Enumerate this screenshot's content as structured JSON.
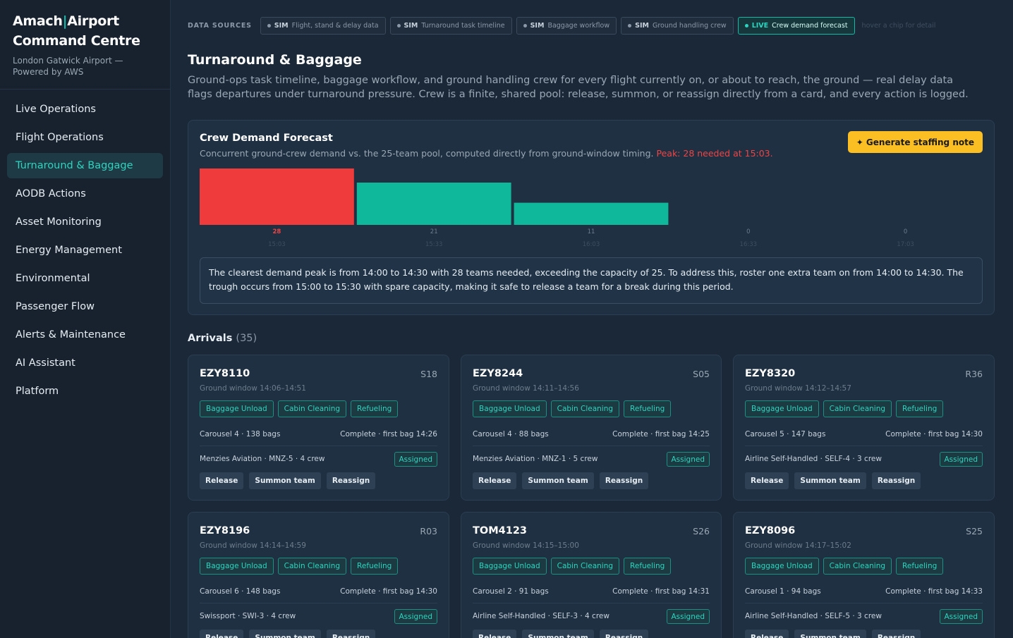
{
  "brand": {
    "name_a": "Amach",
    "name_sep": "|",
    "name_b": "Airport",
    "name_c": "Command Centre",
    "subtitle": "London Gatwick Airport — Powered by AWS"
  },
  "nav": {
    "items": [
      {
        "label": "Live Operations"
      },
      {
        "label": "Flight Operations"
      },
      {
        "label": "Turnaround & Baggage",
        "active": true
      },
      {
        "label": "AODB Actions"
      },
      {
        "label": "Asset Monitoring"
      },
      {
        "label": "Energy Management"
      },
      {
        "label": "Environmental"
      },
      {
        "label": "Passenger Flow"
      },
      {
        "label": "Alerts & Maintenance"
      },
      {
        "label": "AI Assistant"
      },
      {
        "label": "Platform"
      }
    ]
  },
  "sources": {
    "label": "DATA SOURCES",
    "chips": [
      {
        "tag": "SIM",
        "text": "Flight, stand & delay data"
      },
      {
        "tag": "SIM",
        "text": "Turnaround task timeline"
      },
      {
        "tag": "SIM",
        "text": "Baggage workflow"
      },
      {
        "tag": "SIM",
        "text": "Ground handling crew"
      },
      {
        "tag": "LIVE",
        "text": "Crew demand forecast"
      }
    ],
    "hint": "hover a chip for detail"
  },
  "page": {
    "title": "Turnaround & Baggage",
    "description": "Ground-ops task timeline, baggage workflow, and ground handling crew for every flight currently on, or about to reach, the ground — real delay data flags departures under turnaround pressure. Crew is a finite, shared pool: release, summon, or reassign directly from a card, and every action is logged."
  },
  "forecast": {
    "title": "Crew Demand Forecast",
    "subtitle": "Concurrent ground-crew demand vs. the 25-team pool, computed directly from ground-window timing.",
    "peak_text": "Peak: 28 needed at 15:03.",
    "button_label": "✦ Generate staffing note",
    "note": "The clearest demand peak is from 14:00 to 14:30 with 28 teams needed, exceeding the capacity of 25. To address this, roster one extra team on from 14:00 to 14:30. The trough occurs from 15:00 to 15:30 with spare capacity, making it safe to release a team for a break during this period."
  },
  "chart_data": {
    "type": "bar",
    "categories": [
      "15:03",
      "15:33",
      "16:03",
      "16:33",
      "17:03"
    ],
    "values": [
      28,
      21,
      11,
      0,
      0
    ],
    "capacity": 25,
    "colors": {
      "over_capacity": "#ef3b3b",
      "normal": "#0fb89a"
    },
    "title": "",
    "xlabel": "",
    "ylabel": ""
  },
  "arrivals": {
    "title": "Arrivals",
    "count": "(35)",
    "cards": [
      {
        "flight": "EZY8110",
        "stand": "S18",
        "window": "Ground window 14:06–14:51",
        "tasks": [
          "Baggage Unload",
          "Cabin Cleaning",
          "Refueling"
        ],
        "bag": "Carousel 4 · 138 bags",
        "bag_status": "Complete · first bag 14:26",
        "crew": "Menzies Aviation · MNZ-5 · 4 crew",
        "crew_status": "Assigned",
        "actions": [
          "Release",
          "Summon team",
          "Reassign"
        ]
      },
      {
        "flight": "EZY8244",
        "stand": "S05",
        "window": "Ground window 14:11–14:56",
        "tasks": [
          "Baggage Unload",
          "Cabin Cleaning",
          "Refueling"
        ],
        "bag": "Carousel 4 · 88 bags",
        "bag_status": "Complete · first bag 14:25",
        "crew": "Menzies Aviation · MNZ-1 · 5 crew",
        "crew_status": "Assigned",
        "actions": [
          "Release",
          "Summon team",
          "Reassign"
        ]
      },
      {
        "flight": "EZY8320",
        "stand": "R36",
        "window": "Ground window 14:12–14:57",
        "tasks": [
          "Baggage Unload",
          "Cabin Cleaning",
          "Refueling"
        ],
        "bag": "Carousel 5 · 147 bags",
        "bag_status": "Complete · first bag 14:30",
        "crew": "Airline Self-Handled · SELF-4 · 3 crew",
        "crew_status": "Assigned",
        "actions": [
          "Release",
          "Summon team",
          "Reassign"
        ]
      },
      {
        "flight": "EZY8196",
        "stand": "R03",
        "window": "Ground window 14:14–14:59",
        "tasks": [
          "Baggage Unload",
          "Cabin Cleaning",
          "Refueling"
        ],
        "bag": "Carousel 6 · 148 bags",
        "bag_status": "Complete · first bag 14:30",
        "crew": "Swissport · SWI-3 · 4 crew",
        "crew_status": "Assigned",
        "actions": [
          "Release",
          "Summon team",
          "Reassign"
        ]
      },
      {
        "flight": "TOM4123",
        "stand": "S26",
        "window": "Ground window 14:15–15:00",
        "tasks": [
          "Baggage Unload",
          "Cabin Cleaning",
          "Refueling"
        ],
        "bag": "Carousel 2 · 91 bags",
        "bag_status": "Complete · first bag 14:31",
        "crew": "Airline Self-Handled · SELF-3 · 4 crew",
        "crew_status": "Assigned",
        "actions": [
          "Release",
          "Summon team",
          "Reassign"
        ]
      },
      {
        "flight": "EZY8096",
        "stand": "S25",
        "window": "Ground window 14:17–15:02",
        "tasks": [
          "Baggage Unload",
          "Cabin Cleaning",
          "Refueling"
        ],
        "bag": "Carousel 1 · 94 bags",
        "bag_status": "Complete · first bag 14:33",
        "crew": "Airline Self-Handled · SELF-5 · 3 crew",
        "crew_status": "Assigned",
        "actions": [
          "Release",
          "Summon team",
          "Reassign"
        ]
      }
    ]
  }
}
